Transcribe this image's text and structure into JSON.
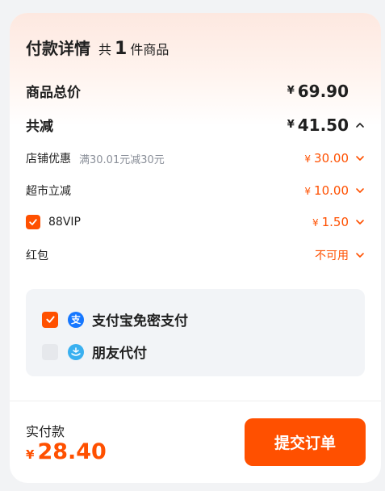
{
  "header": {
    "title": "付款详情",
    "count_prefix": "共",
    "count": "1",
    "count_suffix": "件商品"
  },
  "summary": {
    "total_label": "商品总价",
    "total_currency": "¥",
    "total_amount": "69.90",
    "discount_label": "共减",
    "discount_currency": "¥",
    "discount_amount": "41.50"
  },
  "discounts": [
    {
      "label": "店铺优惠",
      "note": "满30.01元减30元",
      "currency": "¥",
      "amount": "30.00"
    },
    {
      "label": "超市立减",
      "currency": "¥",
      "amount": "10.00"
    },
    {
      "label": "88VIP",
      "currency": "¥",
      "amount": "1.50",
      "checked": true
    },
    {
      "label": "红包",
      "status": "不可用"
    }
  ],
  "payment": {
    "options": [
      {
        "label": "支付宝免密支付",
        "icon": "alipay-icon",
        "icon_glyph": "支",
        "checked": true
      },
      {
        "label": "朋友代付",
        "icon": "friend-pay-icon",
        "checked": false
      }
    ]
  },
  "footer": {
    "label": "实付款",
    "currency": "¥",
    "amount": "28.40",
    "submit_label": "提交订单"
  },
  "colors": {
    "accent": "#ff5000",
    "alipay": "#1677ff",
    "friend_pay": "#3ab0f0"
  }
}
